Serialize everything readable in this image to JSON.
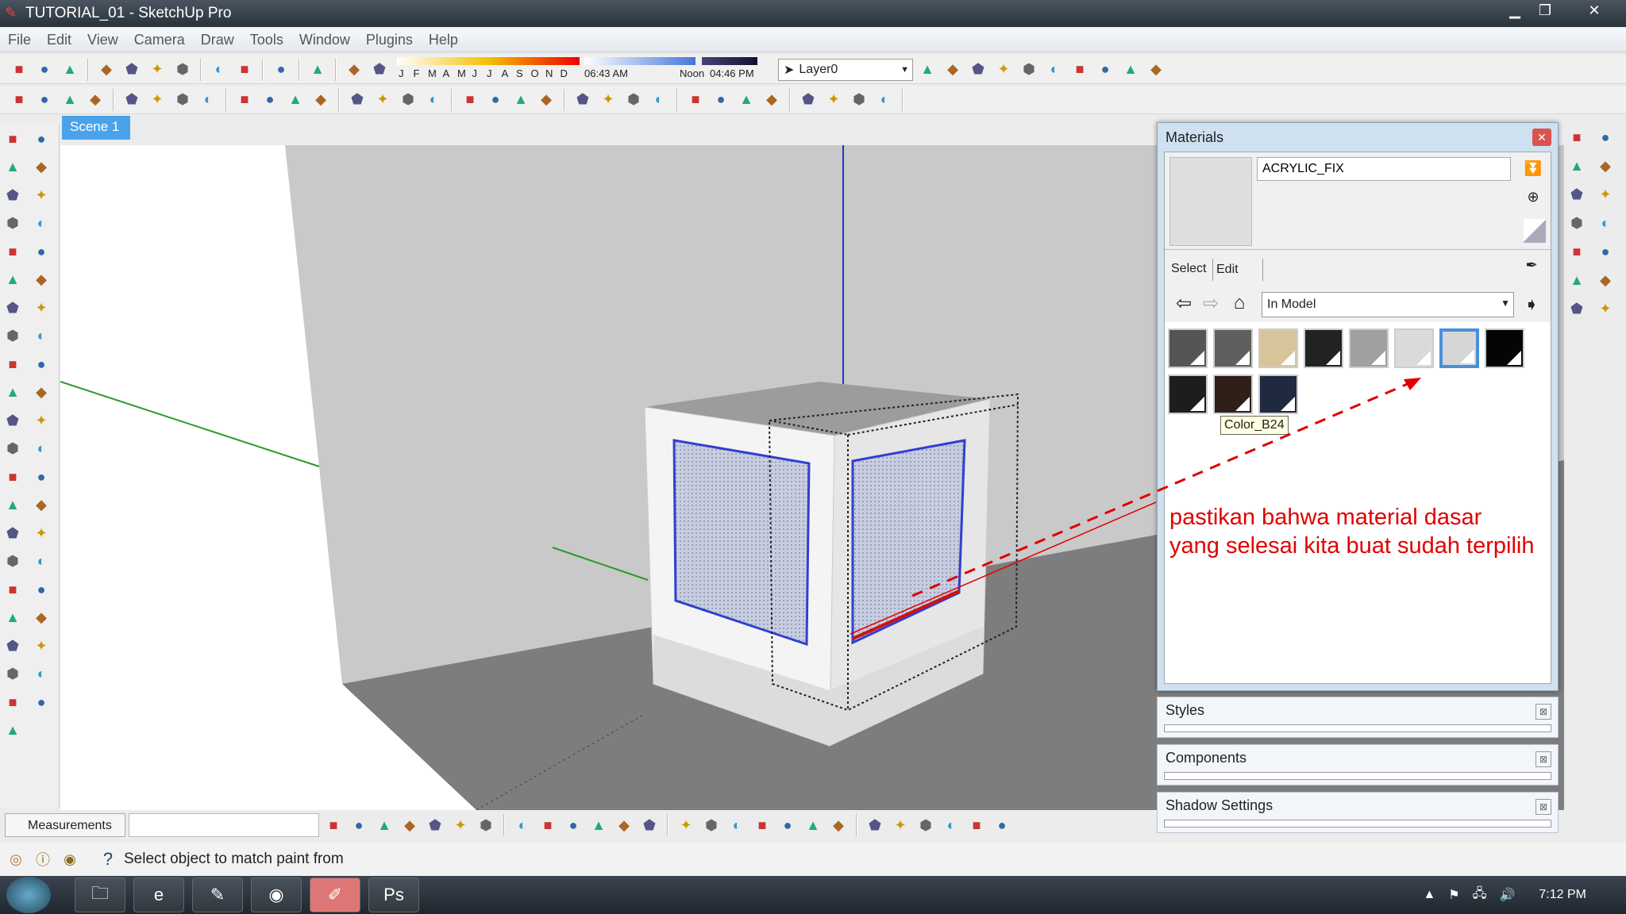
{
  "window": {
    "title": "TUTORIAL_01 - SketchUp Pro"
  },
  "menu": [
    "File",
    "Edit",
    "View",
    "Camera",
    "Draw",
    "Tools",
    "Window",
    "Plugins",
    "Help"
  ],
  "toolbar1": {
    "left_icons": [
      "new-file",
      "open-folder",
      "save",
      "cut",
      "copy",
      "paste",
      "erase",
      "undo",
      "redo",
      "print",
      "model-info"
    ],
    "shadow_icons": [
      "shadow-toggle",
      "shadow-settings"
    ],
    "months": [
      "J",
      "F",
      "M",
      "A",
      "M",
      "J",
      "J",
      "A",
      "S",
      "O",
      "N",
      "D"
    ],
    "time_start": "06:43 AM",
    "time_noon": "Noon",
    "time_end": "04:46 PM",
    "layer": "Layer0",
    "right_icons": [
      "layer-manager",
      "component-a",
      "component-b",
      "sandbox-a",
      "sandbox-b",
      "sandbox-c",
      "photo-match",
      "geo-a",
      "geo-b",
      "geo-c"
    ]
  },
  "toolbar2": {
    "icons": [
      "axes",
      "section-plane",
      "flip-red",
      "flip-green",
      "align",
      "unfold",
      "rotate-left",
      "rotate-right",
      "flip-blue",
      "skin",
      "xy-plane",
      "sub",
      "play",
      "stop",
      "help-2",
      "orbit",
      "pan",
      "triangle",
      "compass",
      "line",
      "stamp",
      "drape",
      "smoove",
      "flip-edge",
      "terrain-a",
      "terrain-b",
      "tool-a",
      "tool-b",
      "tool-c",
      "tool-d",
      "tool-e",
      "arc-tool"
    ]
  },
  "scene": {
    "tab": "Scene 1"
  },
  "left_tools": [
    "select",
    "component",
    "paint-bucket",
    "eraser",
    "rectangle",
    "pencil",
    "circle",
    "arc",
    "polygon",
    "freehand",
    "move",
    "push-pull",
    "rotate",
    "follow-me",
    "scale",
    "offset",
    "tape-measure",
    "dimension",
    "protractor",
    "text",
    "axes",
    "3d-text",
    "orbit",
    "pan",
    "zoom",
    "zoom-extents",
    "zoom-window",
    "previous-view",
    "position-camera",
    "look-around",
    "walk",
    "section",
    "model-a",
    "model-b",
    "model-c",
    "model-d",
    "tag",
    "sphere",
    "sandbox",
    "flag",
    "diamond",
    "star",
    "misc"
  ],
  "right_tools": [
    "orbit-r",
    "paint-r",
    "r1",
    "r2",
    "box",
    "cube",
    "sandbox-r",
    "r3",
    "r4",
    "r5",
    "r6",
    "r7",
    "r8",
    "r9"
  ],
  "materials": {
    "title": "Materials",
    "name": "ACRYLIC_FIX",
    "tab_select": "Select",
    "tab_edit": "Edit",
    "library": "In Model",
    "swatches": [
      "#555555",
      "#5f5f5f",
      "#d8c49a",
      "#222222",
      "#a0a0a0",
      "#dadada",
      "#d6d6d6",
      "#050505",
      "#1d1d1d",
      "#2e2018",
      "#1f2a40"
    ],
    "selected_index": 6,
    "tooltip": "Color_B24",
    "accent": "#4a90d9"
  },
  "annotation": {
    "line1": "pastikan bahwa material dasar",
    "line2": "yang selesai kita buat sudah terpilih",
    "color": "#e00000"
  },
  "panels": [
    "Styles",
    "Components",
    "Shadow Settings"
  ],
  "measurements": {
    "label": "Measurements",
    "icons": [
      "xray",
      "back-edges",
      "wireframe",
      "hidden-line",
      "shaded",
      "textured",
      "monochrome",
      "view-iso",
      "view-top",
      "view-front",
      "view-right",
      "view-back",
      "view-left",
      "style-a",
      "style-b",
      "style-c",
      "style-d",
      "style-e",
      "style-f",
      "style-g",
      "warehouse",
      "component-maker",
      "home",
      "section-cut",
      "house",
      "section-fill"
    ]
  },
  "status": {
    "text": "Select object to match paint from"
  },
  "taskbar": {
    "apps": [
      "explorer",
      "ie",
      "paint",
      "chrome",
      "sketchup",
      "photoshop"
    ],
    "clock": "7:12 PM"
  }
}
